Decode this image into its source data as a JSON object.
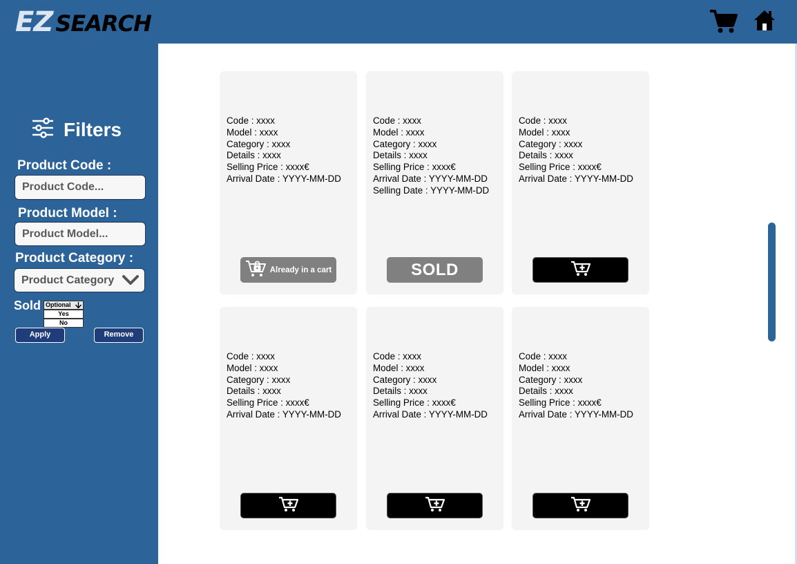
{
  "header": {
    "logo_ez": "EZ",
    "logo_search": "SEARCH",
    "cart_icon": "cart-icon",
    "home_icon": "home-icon"
  },
  "sidebar": {
    "title": "Filters",
    "title_icon": "sliders-icon",
    "product_code": {
      "label": "Product Code :",
      "placeholder": "Product Code..."
    },
    "product_model": {
      "label": "Product Model :",
      "placeholder": "Product Model..."
    },
    "product_category": {
      "label": "Product Category :",
      "value": "Product Category"
    },
    "sold": {
      "label": "Sold",
      "options": [
        "Optional",
        "Yes",
        "No"
      ]
    },
    "apply_label": "Apply",
    "remove_label": "Remove"
  },
  "products": [
    {
      "code": "Code : xxxx",
      "model": "Model : xxxx",
      "category": "Category : xxxx",
      "details": "Details : xxxx",
      "price": "Selling Price : xxxx€",
      "arrival": "Arrival Date : YYYY-MM-DD",
      "selling_date": "",
      "button_state": "in-cart",
      "button_label": "Already in a cart"
    },
    {
      "code": "Code : xxxx",
      "model": "Model : xxxx",
      "category": "Category : xxxx",
      "details": "Details : xxxx",
      "price": "Selling Price : xxxx€",
      "arrival": "Arrival Date : YYYY-MM-DD",
      "selling_date": "Selling Date : YYYY-MM-DD",
      "button_state": "sold",
      "button_label": "SOLD"
    },
    {
      "code": "Code : xxxx",
      "model": "Model : xxxx",
      "category": "Category : xxxx",
      "details": "Details : xxxx",
      "price": "Selling Price : xxxx€",
      "arrival": "Arrival Date : YYYY-MM-DD",
      "selling_date": "",
      "button_state": "add",
      "button_label": ""
    },
    {
      "code": "Code : xxxx",
      "model": "Model : xxxx",
      "category": "Category : xxxx",
      "details": "Details : xxxx",
      "price": "Selling Price : xxxx€",
      "arrival": "Arrival Date : YYYY-MM-DD",
      "selling_date": "",
      "button_state": "add",
      "button_label": ""
    },
    {
      "code": "Code : xxxx",
      "model": "Model : xxxx",
      "category": "Category : xxxx",
      "details": "Details : xxxx",
      "price": "Selling Price : xxxx€",
      "arrival": "Arrival Date : YYYY-MM-DD",
      "selling_date": "",
      "button_state": "add",
      "button_label": ""
    },
    {
      "code": "Code : xxxx",
      "model": "Model : xxxx",
      "category": "Category : xxxx",
      "details": "Details : xxxx",
      "price": "Selling Price : xxxx€",
      "arrival": "Arrival Date : YYYY-MM-DD",
      "selling_date": "",
      "button_state": "add",
      "button_label": ""
    }
  ],
  "colors": {
    "brand": "#2c6398",
    "card_bg": "#f4f4f4",
    "sold_button": "#808080",
    "add_button": "#000000"
  }
}
